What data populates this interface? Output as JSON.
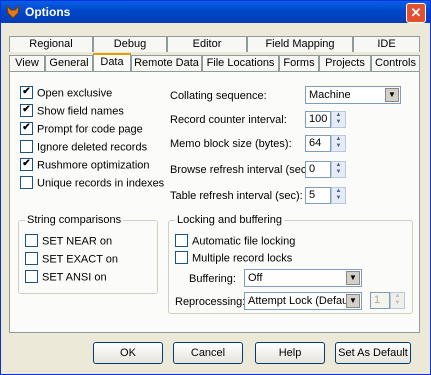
{
  "window": {
    "title": "Options",
    "close": "✕"
  },
  "tabs_back": [
    {
      "label": "Regional"
    },
    {
      "label": "Debug"
    },
    {
      "label": "Editor"
    },
    {
      "label": "Field Mapping"
    },
    {
      "label": "IDE"
    }
  ],
  "tabs_front": [
    {
      "label": "View"
    },
    {
      "label": "General"
    },
    {
      "label": "Data"
    },
    {
      "label": "Remote Data"
    },
    {
      "label": "File Locations"
    },
    {
      "label": "Forms"
    },
    {
      "label": "Projects"
    },
    {
      "label": "Controls"
    }
  ],
  "options": [
    {
      "label": "Open exclusive",
      "checked": true
    },
    {
      "label": "Show field names",
      "checked": true
    },
    {
      "label": "Prompt for code page",
      "checked": true
    },
    {
      "label": "Ignore deleted records",
      "checked": false
    },
    {
      "label": "Rushmore optimization",
      "checked": true
    },
    {
      "label": "Unique records in indexes",
      "checked": false
    }
  ],
  "right_fields": {
    "collating_label": "Collating sequence:",
    "collating_value": "Machine",
    "record_counter_label": "Record counter interval:",
    "record_counter_value": "100",
    "memo_label": "Memo block size (bytes):",
    "memo_value": "64",
    "browse_label": "Browse refresh interval (sec):",
    "browse_value": "0",
    "table_label": "Table refresh interval (sec):",
    "table_value": "5"
  },
  "string_group": {
    "title": "String comparisons",
    "items": [
      {
        "label": "SET NEAR on"
      },
      {
        "label": "SET EXACT on"
      },
      {
        "label": "SET ANSI on"
      }
    ]
  },
  "lock_group": {
    "title": "Locking and buffering",
    "auto_lock": "Automatic file locking",
    "multi_lock": "Multiple record locks",
    "buffering_label": "Buffering:",
    "buffering_value": "Off",
    "reprocessing_label": "Reprocessing:",
    "reprocessing_value": "Attempt Lock (Default",
    "reprocessing_count": "1"
  },
  "buttons": {
    "ok": "OK",
    "cancel": "Cancel",
    "help": "Help",
    "default": "Set As Default"
  }
}
